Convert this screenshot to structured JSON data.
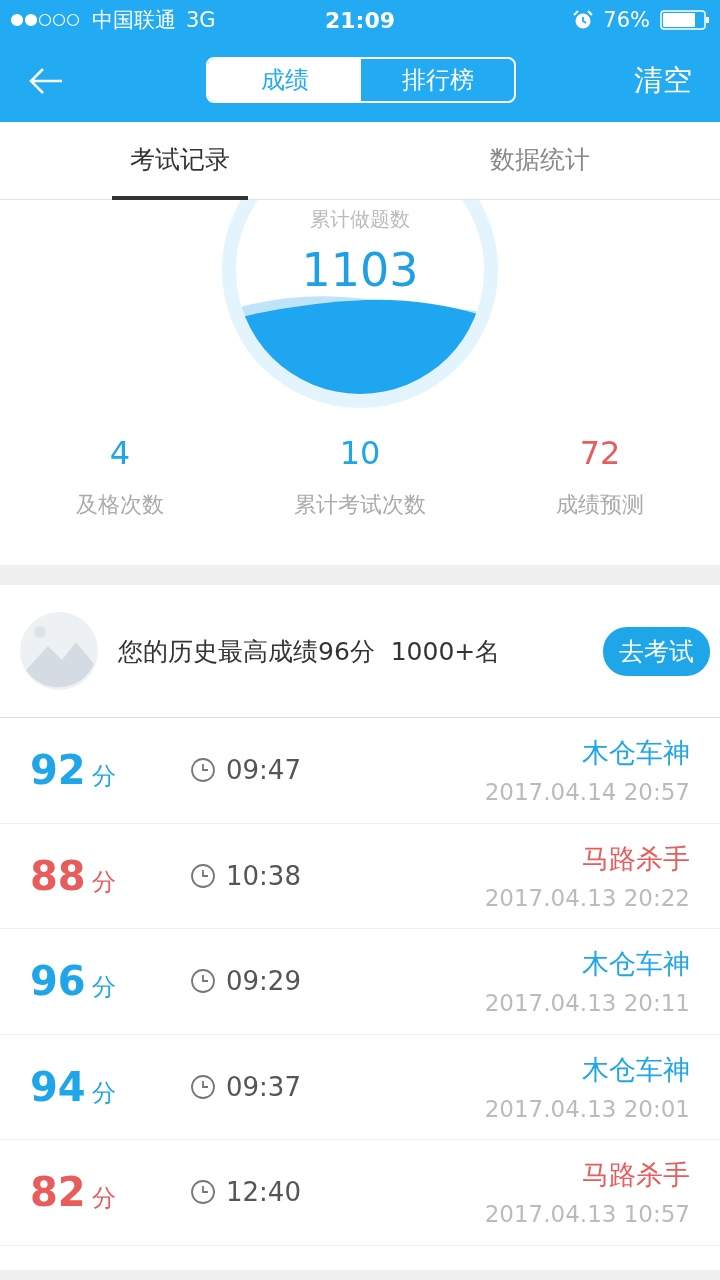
{
  "status_bar": {
    "carrier": "中国联通",
    "network": "3G",
    "time": "21:09",
    "battery": "76%"
  },
  "nav": {
    "segments": [
      {
        "label": "成绩",
        "selected": true
      },
      {
        "label": "排行榜",
        "selected": false
      }
    ],
    "action": "清空"
  },
  "tabs": [
    {
      "label": "考试记录",
      "selected": true
    },
    {
      "label": "数据统计",
      "selected": false
    }
  ],
  "summary": {
    "label": "累计做题数",
    "value": "1103"
  },
  "stats": [
    {
      "value": "4",
      "label": "及格次数",
      "color": "#1fa6e8"
    },
    {
      "value": "10",
      "label": "累计考试次数",
      "color": "#1fa6e8"
    },
    {
      "value": "72",
      "label": "成绩预测",
      "color": "#e85c5c"
    }
  ],
  "best": {
    "text": "您的历史最高成绩96分  1000+名",
    "button": "去考试"
  },
  "records": [
    {
      "score": "92",
      "unit": "分",
      "time": "09:47",
      "title": "木仓车神",
      "date": "2017.04.14 20:57",
      "color": "#1fa6e8"
    },
    {
      "score": "88",
      "unit": "分",
      "time": "10:38",
      "title": "马路杀手",
      "date": "2017.04.13 20:22",
      "color": "#e85c5c"
    },
    {
      "score": "96",
      "unit": "分",
      "time": "09:29",
      "title": "木仓车神",
      "date": "2017.04.13 20:11",
      "color": "#1fa6e8"
    },
    {
      "score": "94",
      "unit": "分",
      "time": "09:37",
      "title": "木仓车神",
      "date": "2017.04.13 20:01",
      "color": "#1fa6e8"
    },
    {
      "score": "82",
      "unit": "分",
      "time": "12:40",
      "title": "马路杀手",
      "date": "2017.04.13 10:57",
      "color": "#e85c5c"
    }
  ]
}
